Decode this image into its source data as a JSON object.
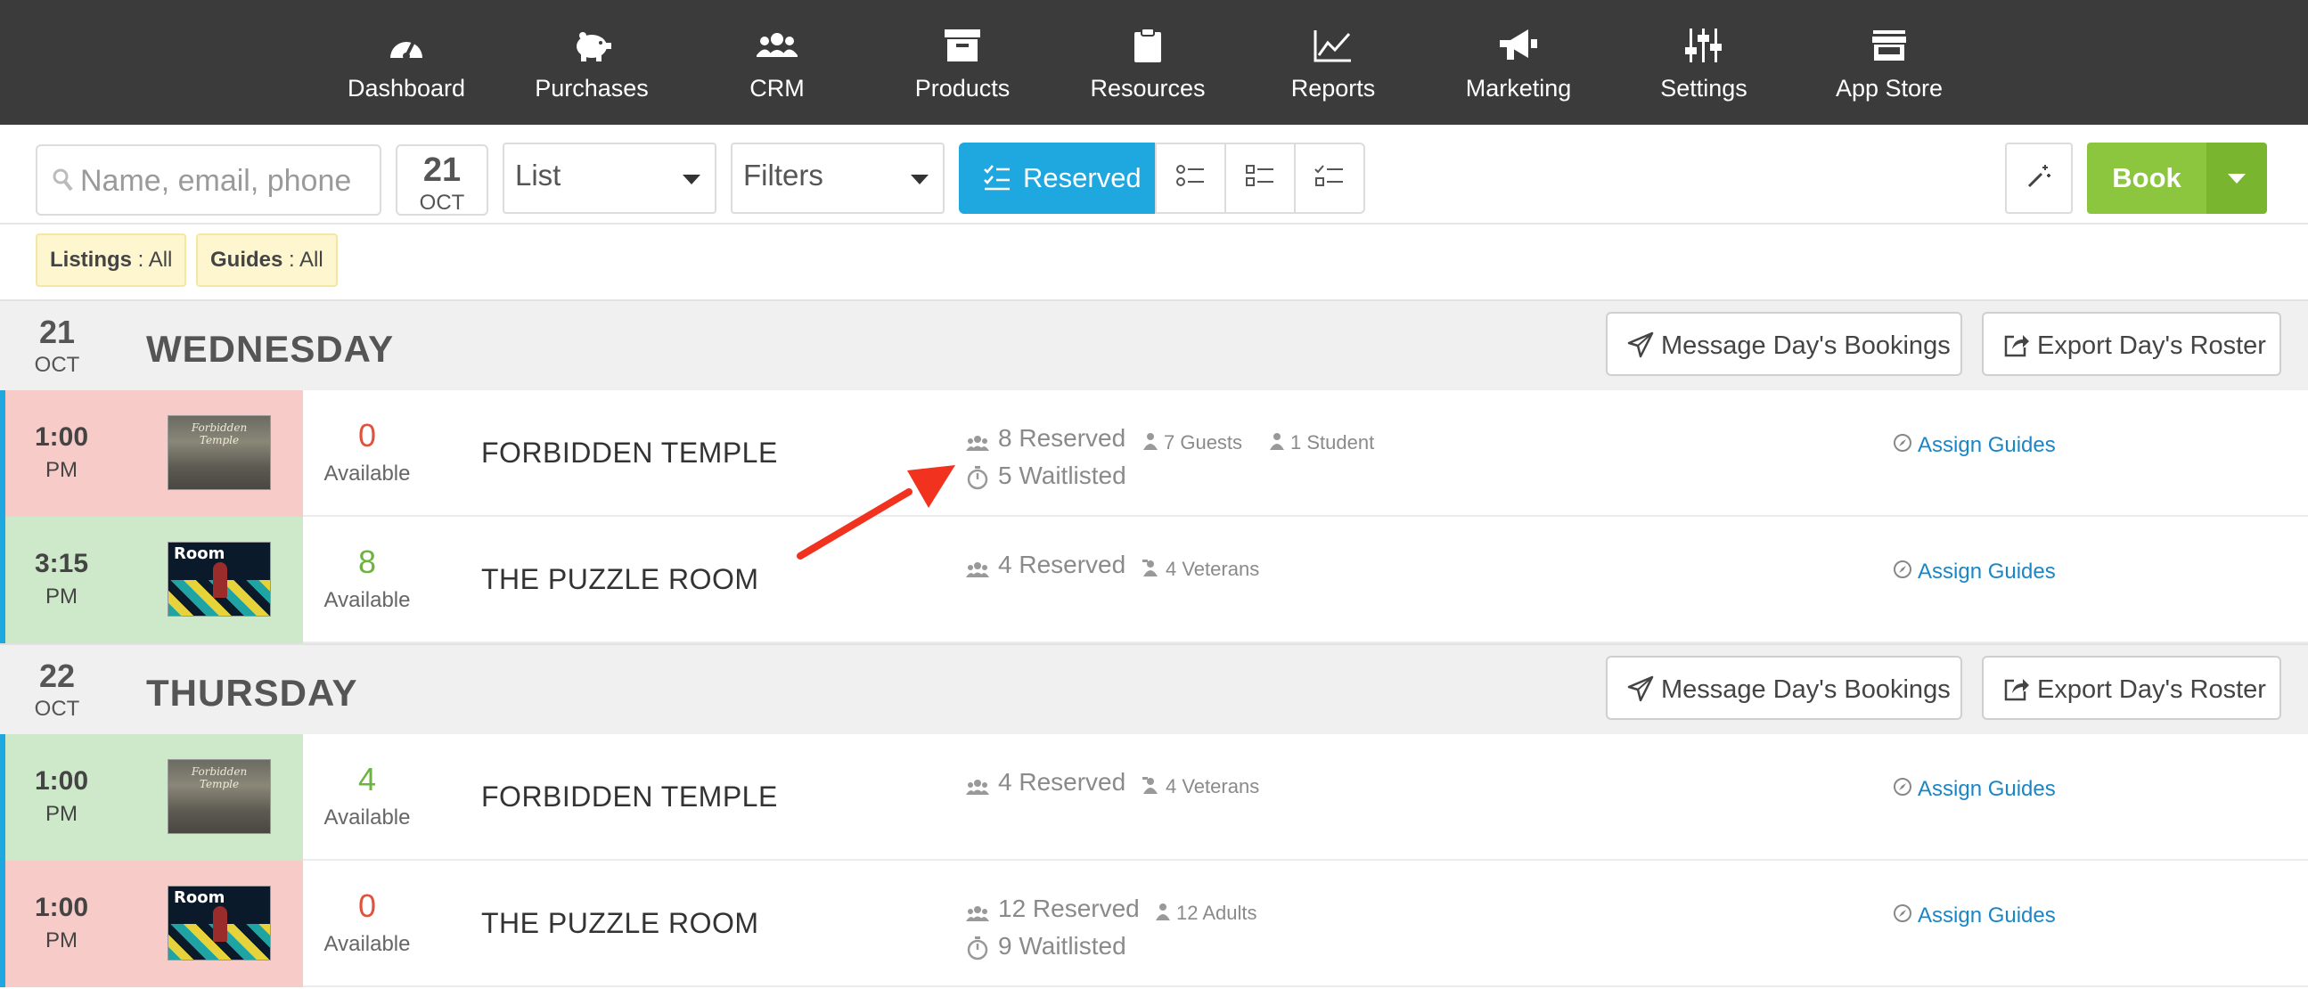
{
  "nav": {
    "items": [
      {
        "label": "Dashboard",
        "icon": "gauge-icon"
      },
      {
        "label": "Purchases",
        "icon": "piggy-bank-icon"
      },
      {
        "label": "CRM",
        "icon": "users-icon"
      },
      {
        "label": "Products",
        "icon": "archive-box-icon"
      },
      {
        "label": "Resources",
        "icon": "clipboard-icon"
      },
      {
        "label": "Reports",
        "icon": "line-chart-icon"
      },
      {
        "label": "Marketing",
        "icon": "megaphone-icon"
      },
      {
        "label": "Settings",
        "icon": "sliders-icon"
      },
      {
        "label": "App Store",
        "icon": "store-icon"
      }
    ]
  },
  "toolbar": {
    "search_placeholder": "Name, email, phone",
    "date_day": "21",
    "date_month": "OCT",
    "view_select": "List",
    "filters_select": "Filters",
    "reserved_label": "Reserved",
    "book_label": "Book"
  },
  "chips": [
    {
      "key": "Listings",
      "value": " : All"
    },
    {
      "key": "Guides",
      "value": " : All"
    }
  ],
  "days": [
    {
      "day": "21",
      "month": "OCT",
      "name": "WEDNESDAY",
      "message_label": "Message Day's Bookings",
      "export_label": "Export Day's Roster",
      "rows": [
        {
          "time": "1:00",
          "ampm": "PM",
          "available": "0",
          "available_label": "Available",
          "listing": "FORBIDDEN TEMPLE",
          "thumb_text": "Forbidden Temple",
          "reserved": "8 Reserved",
          "subs": [
            "7 Guests",
            "1 Student"
          ],
          "waitlisted": "5 Waitlisted",
          "assign": "Assign Guides"
        },
        {
          "time": "3:15",
          "ampm": "PM",
          "available": "8",
          "available_label": "Available",
          "listing": "THE PUZZLE ROOM",
          "thumb_text": "Room",
          "reserved": "4 Reserved",
          "subs": [
            "4 Veterans"
          ],
          "waitlisted": "",
          "assign": "Assign Guides"
        }
      ]
    },
    {
      "day": "22",
      "month": "OCT",
      "name": "THURSDAY",
      "message_label": "Message Day's Bookings",
      "export_label": "Export Day's Roster",
      "rows": [
        {
          "time": "1:00",
          "ampm": "PM",
          "available": "4",
          "available_label": "Available",
          "listing": "FORBIDDEN TEMPLE",
          "thumb_text": "Forbidden Temple",
          "reserved": "4 Reserved",
          "subs": [
            "4 Veterans"
          ],
          "waitlisted": "",
          "assign": "Assign Guides"
        },
        {
          "time": "1:00",
          "ampm": "PM",
          "available": "0",
          "available_label": "Available",
          "listing": "THE PUZZLE ROOM",
          "thumb_text": "Room",
          "reserved": "12 Reserved",
          "subs": [
            "12 Adults"
          ],
          "waitlisted": "9 Waitlisted",
          "assign": "Assign Guides"
        }
      ]
    }
  ],
  "colors": {
    "nav_bg": "#3b3b3b",
    "accent_blue": "#1fa8e0",
    "book_green": "#8cc63f",
    "sold_out_bg": "#f7cbc7",
    "available_bg": "#cde9c9",
    "arrow_red": "#f0321e"
  }
}
